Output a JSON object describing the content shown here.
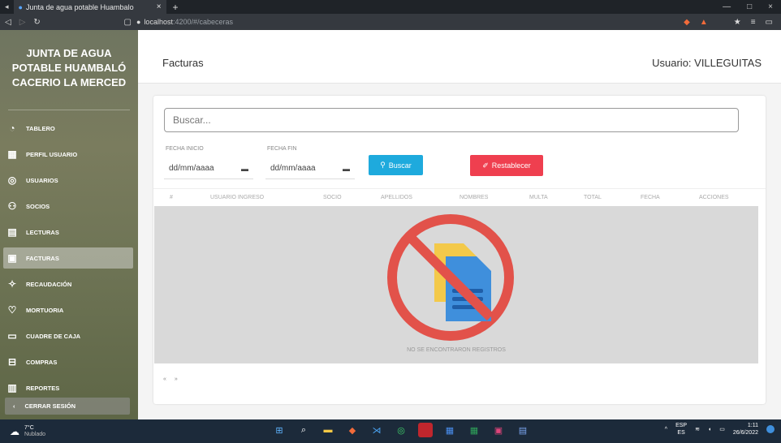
{
  "browser": {
    "tab_title": "Junta de agua potable Huambalo",
    "url_host": "localhost",
    "url_path": ":4200/#/cabeceras"
  },
  "sidebar": {
    "brand": [
      "JUNTA DE AGUA",
      "POTABLE HUAMBALÓ",
      "CACERIO LA MERCED"
    ],
    "items": [
      {
        "label": "TABLERO",
        "icon": "dashboard-icon"
      },
      {
        "label": "PERFIL USUARIO",
        "icon": "profile-icon"
      },
      {
        "label": "USUARIOS",
        "icon": "users-icon"
      },
      {
        "label": "SOCIOS",
        "icon": "partners-icon"
      },
      {
        "label": "LECTURAS",
        "icon": "readings-icon"
      },
      {
        "label": "FACTURAS",
        "icon": "invoice-icon"
      },
      {
        "label": "RECAUDACIÓN",
        "icon": "collection-icon"
      },
      {
        "label": "MORTUORIA",
        "icon": "heart-icon"
      },
      {
        "label": "CUADRE DE CAJA",
        "icon": "cashbox-icon"
      },
      {
        "label": "COMPRAS",
        "icon": "purchases-icon"
      },
      {
        "label": "REPORTES",
        "icon": "reports-icon"
      }
    ],
    "active_index": 5,
    "logout_label": "CERRAR SESIÓN"
  },
  "header": {
    "title": "Facturas",
    "user": "Usuario: VILLEGUITAS"
  },
  "filters": {
    "search_placeholder": "Buscar...",
    "start_label": "FECHA INICIO",
    "end_label": "FECHA FIN",
    "date_placeholder": "dd/mm/aaaa",
    "search_button": "Buscar",
    "reset_button": "Restablecer"
  },
  "table": {
    "columns": [
      "#",
      "USUARIO INGRESO",
      "SOCIO",
      "APELLIDOS",
      "NOMBRES",
      "MULTA",
      "TOTAL",
      "FECHA",
      "ACCIONES"
    ],
    "empty_message": "NO SE ENCONTRARON REGISTROS"
  },
  "pager": {
    "prev": "«",
    "next": "»"
  },
  "taskbar": {
    "temperature": "7°C",
    "weather": "Nublado",
    "lang": "ESP",
    "lang_sub": "ES",
    "time": "1:11",
    "date": "26/6/2022"
  },
  "colors": {
    "primary": "#1eaadd",
    "danger": "#ef3f4f"
  }
}
